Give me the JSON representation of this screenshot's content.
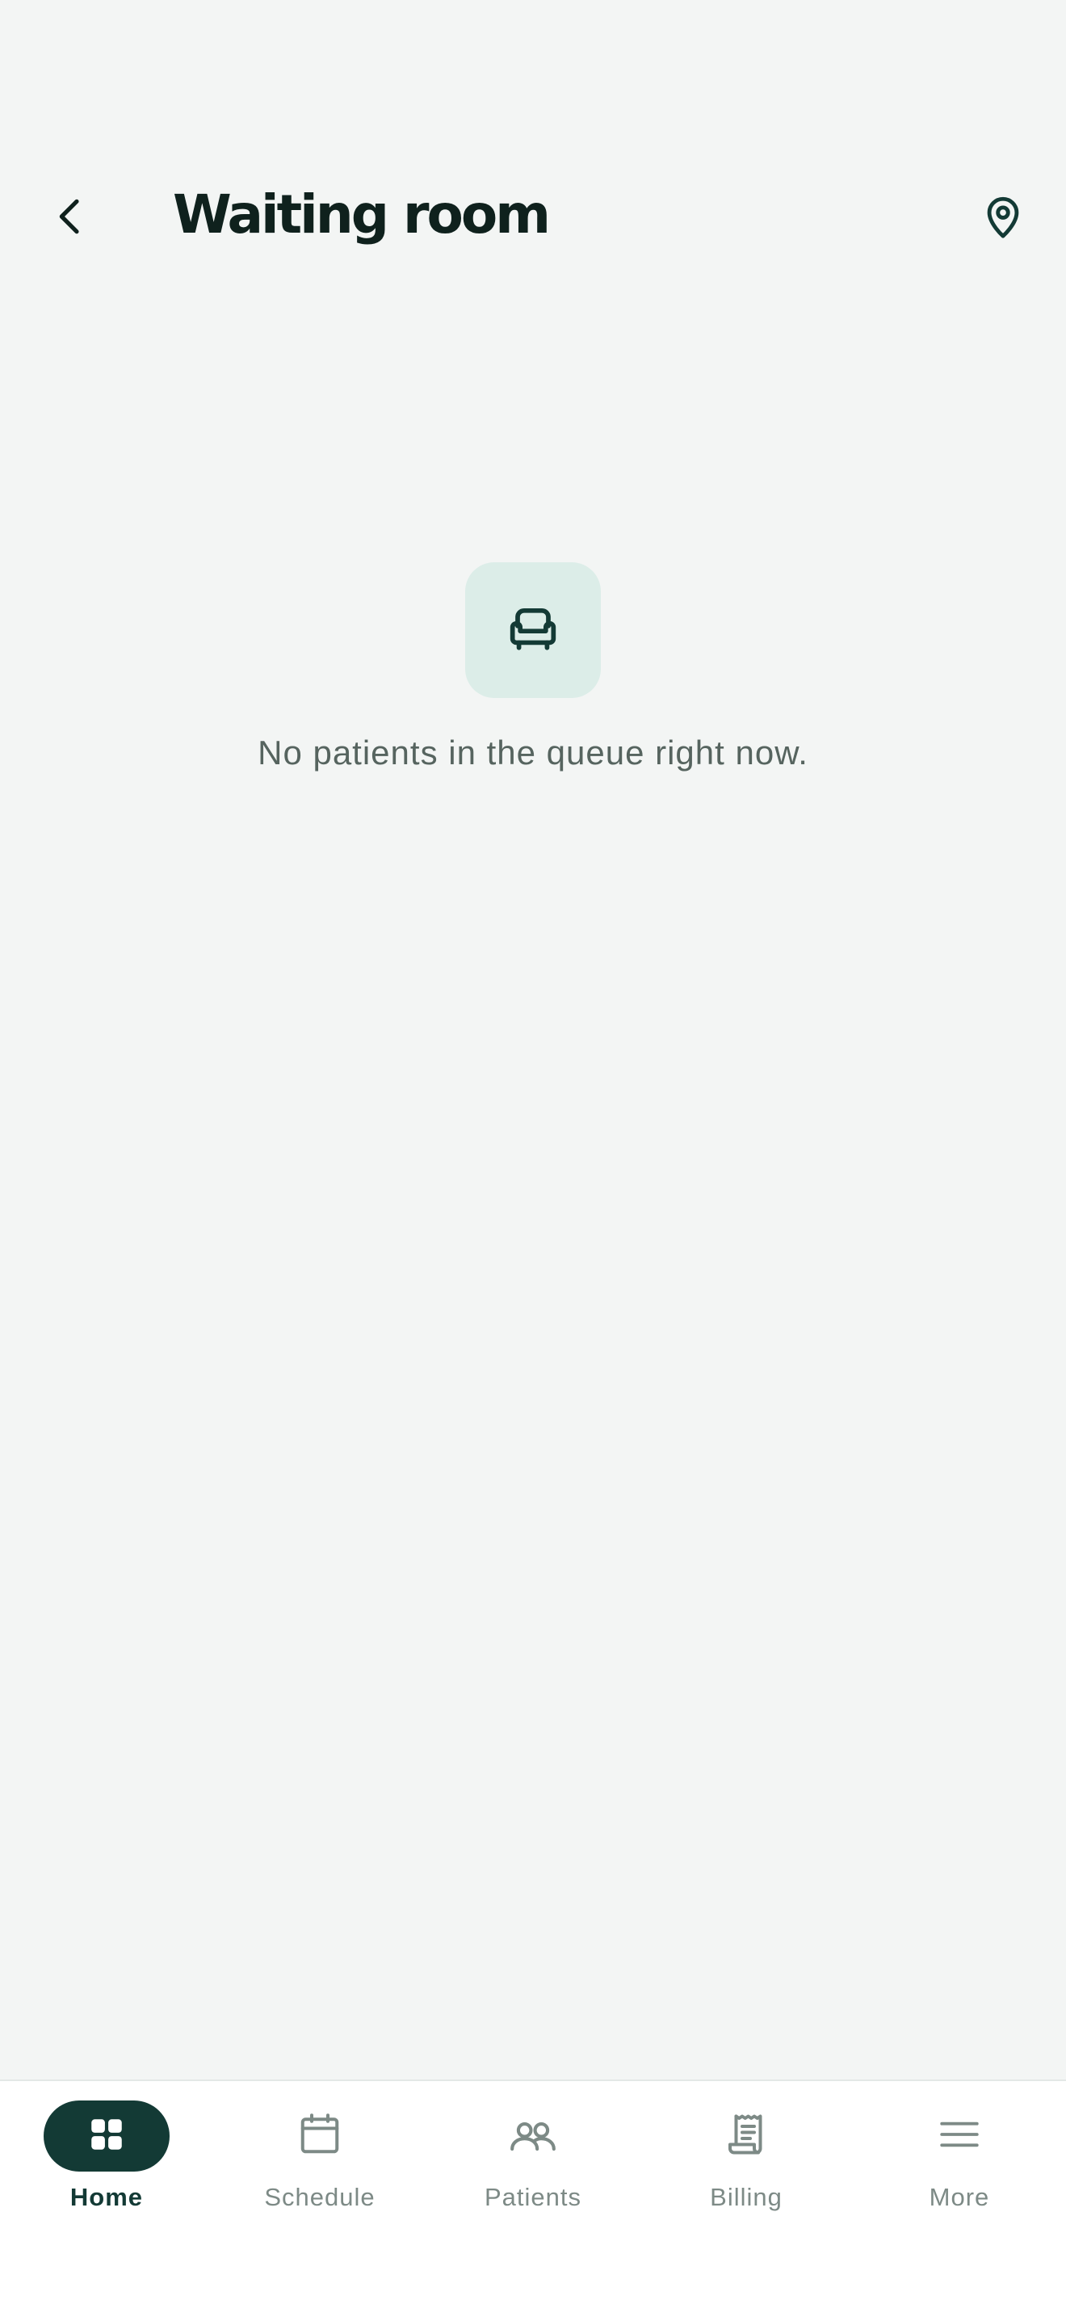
{
  "header": {
    "title": "Waiting room",
    "back_icon": "chevron-left-icon",
    "location_icon": "map-pin-icon"
  },
  "empty_state": {
    "icon": "armchair-icon",
    "message": "No patients in the queue right now."
  },
  "bottom_nav": {
    "items": [
      {
        "label": "Home",
        "icon": "grid-icon",
        "active": true
      },
      {
        "label": "Schedule",
        "icon": "calendar-icon",
        "active": false
      },
      {
        "label": "Patients",
        "icon": "users-icon",
        "active": false
      },
      {
        "label": "Billing",
        "icon": "receipt-icon",
        "active": false
      },
      {
        "label": "More",
        "icon": "menu-icon",
        "active": false
      }
    ]
  },
  "colors": {
    "background": "#f3f5f4",
    "primary_dark": "#133a35",
    "title": "#0f211d",
    "empty_icon_bg": "#dcede8",
    "muted_text": "#56645f",
    "nav_inactive": "#7d8a86"
  }
}
